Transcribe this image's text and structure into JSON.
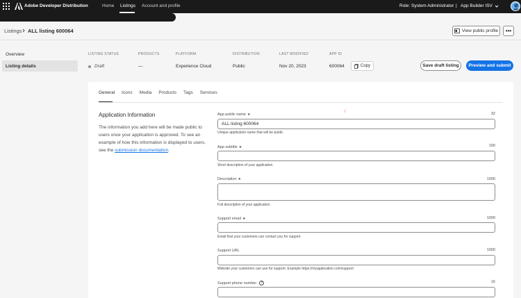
{
  "topbar": {
    "brand": "Adobe Developer Distribution",
    "nav": [
      "Home",
      "Listings",
      "Account and profile"
    ],
    "active_nav": "Listings",
    "role": "Role: System Administrator",
    "separator": "|",
    "org": "App Builder ISV",
    "icons": [
      "app-switcher-icon",
      "adobe-logo-icon",
      "chevron-down-icon",
      "avatar"
    ]
  },
  "header": {
    "breadcrumb_root": "Listings",
    "breadcrumb_current": "ALL listing 600064",
    "view_public_profile": "View public profile",
    "more": "•••"
  },
  "sidebar": {
    "items": [
      {
        "label": "Overview",
        "active": false
      },
      {
        "label": "Listing details",
        "active": true
      }
    ]
  },
  "listing_meta": {
    "status_label": "LISTING STATUS",
    "status_value": "Draft",
    "products_label": "PRODUCTS",
    "products_value": "—",
    "platform_label": "PLATFORM",
    "platform_value": "Experience Cloud",
    "distribution_label": "DISTRIBUTION",
    "distribution_value": "Public",
    "modified_label": "LAST MODIFIED",
    "modified_value": "Nov 20, 2023",
    "appid_label": "APP ID",
    "appid_value": "600064",
    "copy": "Copy",
    "save_draft": "Save draft listing",
    "preview_submit": "Preview and submit"
  },
  "tabs": [
    "General",
    "Icons",
    "Media",
    "Products",
    "Tags",
    "Services"
  ],
  "active_tab": "General",
  "section": {
    "title": "Application Information",
    "desc_text": "The information you add here will be made public to users once your application is approved. To see an example of how this information is displayed to users, see the",
    "desc_link": "submission documentation",
    "desc_end": ".",
    "red_mark": "/"
  },
  "fields": {
    "app_name": {
      "label": "App public name",
      "required": "★",
      "count": "32",
      "value": "ALL listing 600064",
      "help": "Unique application name that will be public"
    },
    "subtitle": {
      "label": "App subtitle",
      "required": "★",
      "count": "100",
      "value": "",
      "help": "Short description of your application"
    },
    "description": {
      "label": "Description",
      "required": "★",
      "count": "1000",
      "value": "",
      "help": "Full description of your application"
    },
    "support_email": {
      "label": "Support email",
      "required": "★",
      "count": "1000",
      "value": "",
      "help": "Email that your customers can contact you for support"
    },
    "support_url": {
      "label": "Support URL",
      "count": "1000",
      "value": "",
      "help": "Website your customers can use for support. Example https://myapplication.com/support"
    },
    "support_phone": {
      "label": "Support phone number",
      "count": "16",
      "help_icon": "?",
      "value": ""
    }
  },
  "colors": {
    "accent": "#1473e6",
    "topbar": "#1a1a1a",
    "background": "#f5f5f5"
  }
}
